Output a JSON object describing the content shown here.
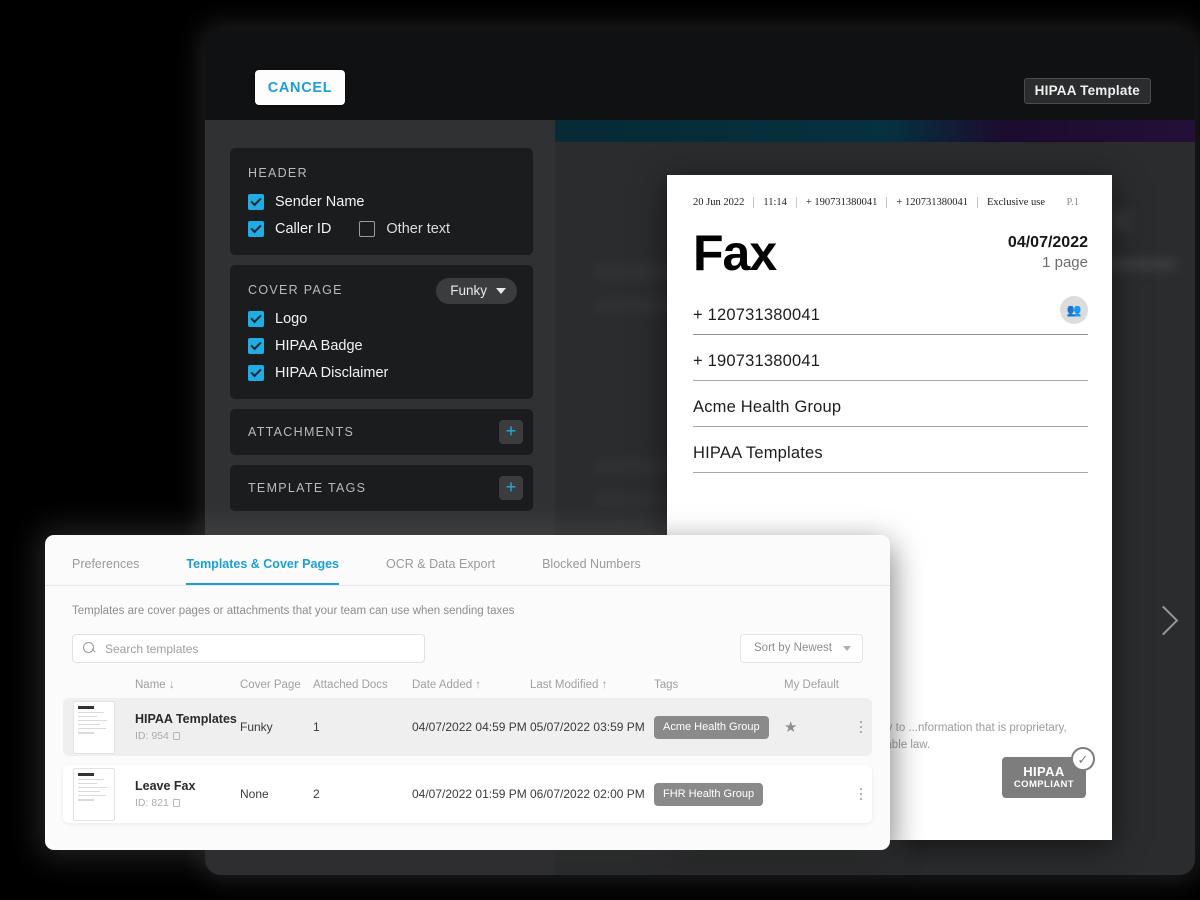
{
  "app": {
    "cancel_label": "CANCEL",
    "template_chip": "HIPAA Template"
  },
  "editor": {
    "header_card": {
      "title": "HEADER",
      "options": [
        {
          "label": "Sender Name",
          "checked": true
        },
        {
          "label": "Caller ID",
          "checked": true
        },
        {
          "label": "Other text",
          "checked": false
        }
      ]
    },
    "cover_card": {
      "title": "COVER PAGE",
      "selected_cover": "Funky",
      "options": [
        {
          "label": "Logo",
          "checked": true
        },
        {
          "label": "HIPAA Badge",
          "checked": true
        },
        {
          "label": "HIPAA Disclaimer",
          "checked": true
        }
      ]
    },
    "attachments": {
      "title": "ATTACHMENTS",
      "add": "+"
    },
    "template_tags": {
      "title": "TEMPLATE TAGS",
      "add": "+"
    }
  },
  "fax": {
    "meta": {
      "date": "20 Jun 2022",
      "time": "11:14",
      "from": "+ 190731380041",
      "to": "+ 120731380041",
      "notice": "Exclusive use",
      "page": "P.1"
    },
    "title": "Fax",
    "doc_date": "04/07/2022",
    "pages": "1 page",
    "fields": [
      "+ 120731380041",
      "+ 190731380041",
      "Acme Health Group",
      "HIPAA Templates"
    ],
    "disclaimer": "...xclusive use of the individual or entity to ...nformation that is proprietary, privileged, ...n disclosure under applicable law.",
    "badge_line1": "HIPAA",
    "badge_line2": "COMPLIANT"
  },
  "settings": {
    "tabs": [
      {
        "label": "Preferences",
        "active": false
      },
      {
        "label": "Templates & Cover Pages",
        "active": true
      },
      {
        "label": "OCR & Data Export",
        "active": false
      },
      {
        "label": "Blocked Numbers",
        "active": false
      }
    ],
    "description": "Templates are cover pages or attachments that your team can use when sending taxes",
    "search_placeholder": "Search templates",
    "search_value": "",
    "sort_label": "Sort by Newest",
    "columns": [
      "Name ↓",
      "Cover Page",
      "Attached Docs",
      "Date Added ↑",
      "Last Modified ↑",
      "Tags",
      "My Default"
    ],
    "rows": [
      {
        "name": "HIPAA Templates",
        "id": "ID: 954",
        "cover_page": "Funky",
        "attached_docs": "1",
        "date_added": "04/07/2022 04:59 PM",
        "last_modified": "05/07/2022 03:59 PM",
        "tag": "Acme Health Group",
        "is_default": true,
        "selected": true
      },
      {
        "name": "Leave Fax",
        "id": "ID: 821",
        "cover_page": "None",
        "attached_docs": "2",
        "date_added": "04/07/2022 01:59 PM",
        "last_modified": "06/07/2022 02:00 PM",
        "tag": "FHR Health Group",
        "is_default": false,
        "selected": false
      }
    ]
  },
  "colors": {
    "accent": "#1b9fd9",
    "checkbox": "#1eaee4",
    "panel_dark": "#1b1c1d",
    "tag": "#8a8a8a"
  }
}
